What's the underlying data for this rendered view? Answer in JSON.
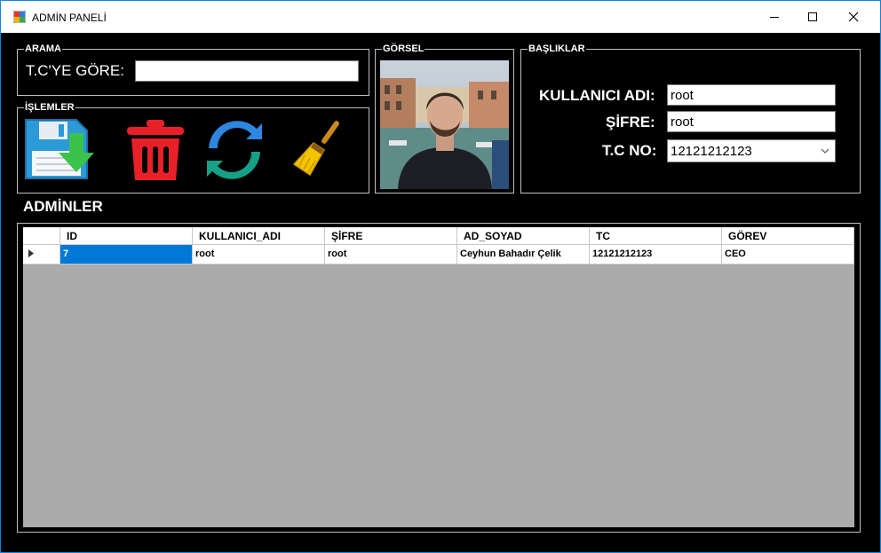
{
  "window": {
    "title": "ADMİN PANELİ"
  },
  "search": {
    "legend": "ARAMA",
    "label": "T.C'YE GÖRE:",
    "value": ""
  },
  "actions": {
    "legend": "İŞLEMLER"
  },
  "image_group": {
    "legend": "GÖRSEL"
  },
  "fields": {
    "legend": "BAŞLIKLAR",
    "username_label": "KULLANICI ADI:",
    "username_value": "root",
    "password_label": "ŞİFRE:",
    "password_value": "root",
    "tc_label": "T.C NO:",
    "tc_value": "12121212123"
  },
  "admins_title": "ADMİNLER",
  "table": {
    "columns": [
      "ID",
      "KULLANICI_ADI",
      "ŞİFRE",
      "AD_SOYAD",
      "TC",
      "GÖREV"
    ],
    "rows": [
      [
        "7",
        "root",
        "root",
        "Ceyhun Bahadır Çelik",
        "12121212123",
        "CEO"
      ]
    ]
  },
  "colors": {
    "selection": "#0078d7",
    "delete_red": "#e8202a",
    "save_blue": "#2d9ad8",
    "save_green": "#3cc24a",
    "refresh_teal": "#16a085",
    "refresh_blue": "#2e86de",
    "broom_yellow": "#f5c400"
  }
}
